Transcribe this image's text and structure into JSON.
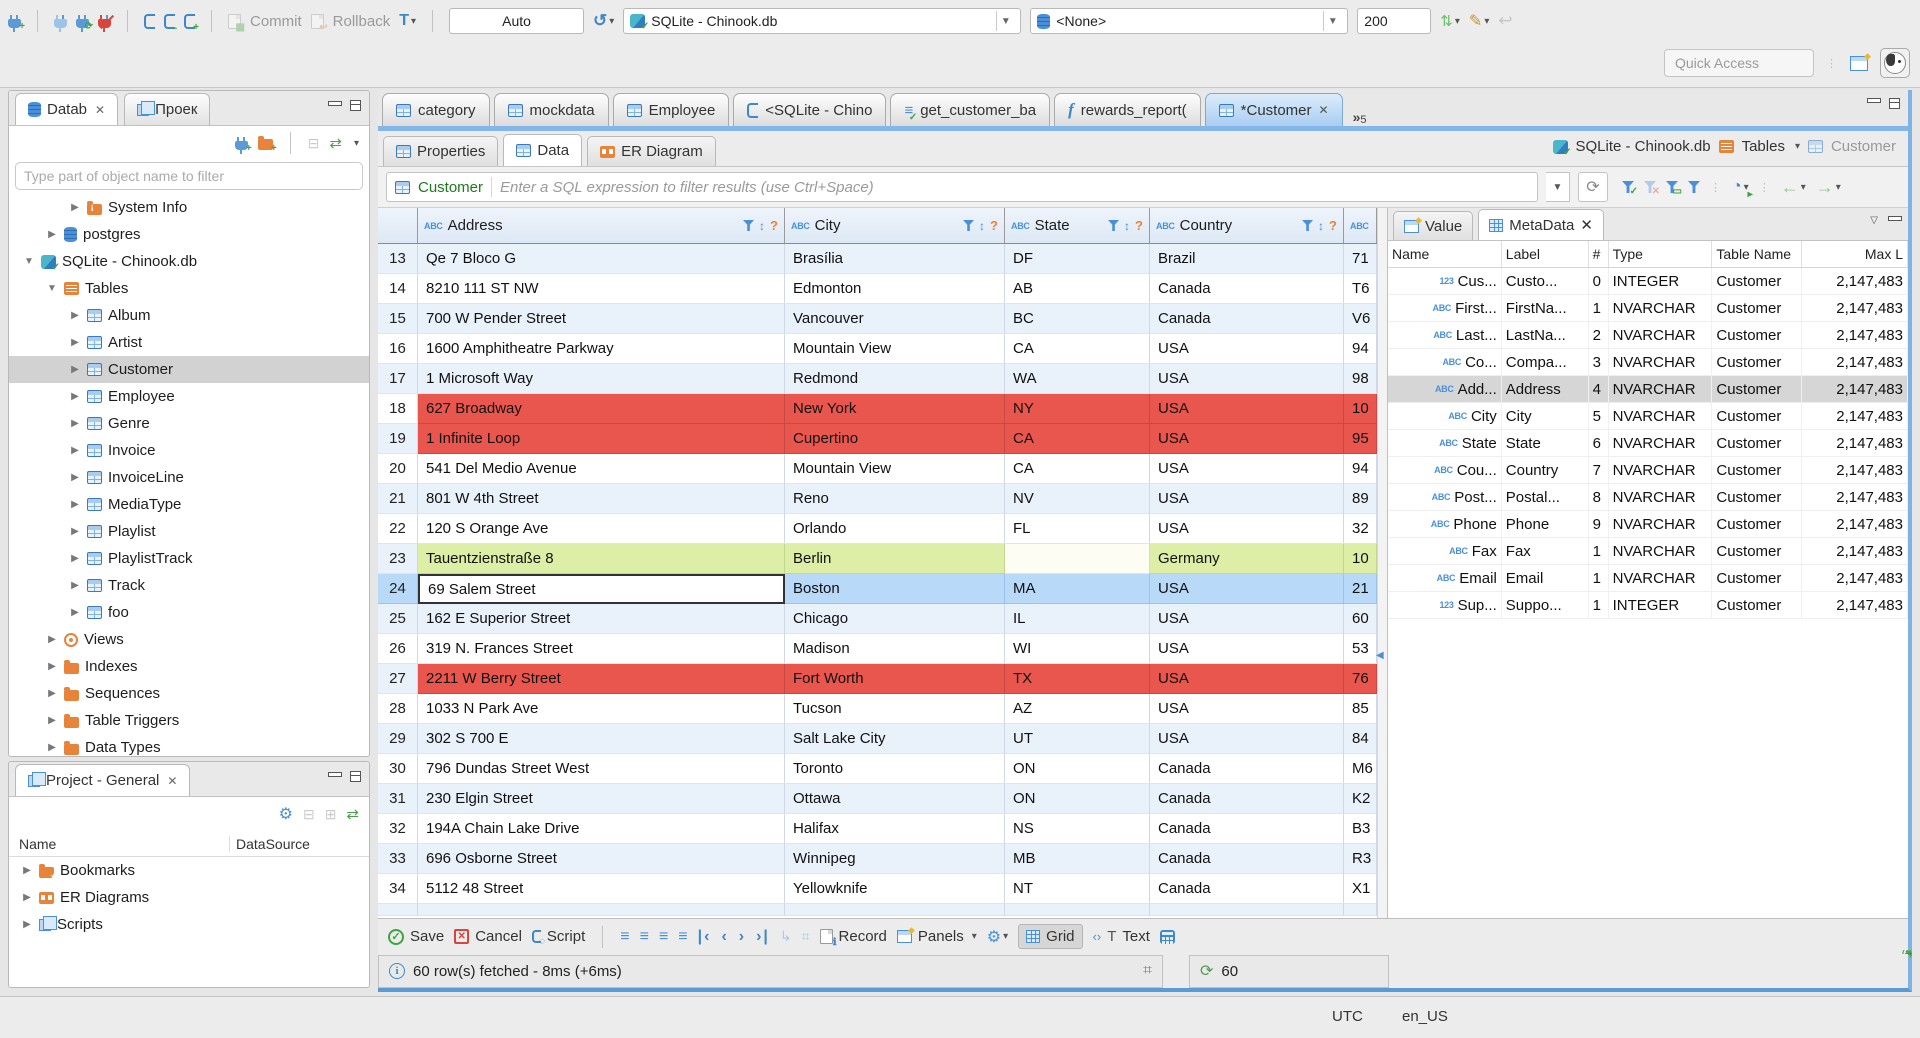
{
  "toolbar": {
    "commit_label": "Commit",
    "rollback_label": "Rollback",
    "txn_mode": "Auto",
    "datasource": "SQLite - Chinook.db",
    "schema": "<None>",
    "fetch_size": "200",
    "quick_access_placeholder": "Quick Access"
  },
  "db_navigator": {
    "tabs": [
      {
        "label": "Datab",
        "closable": true,
        "active": true
      },
      {
        "label": "Проек",
        "closable": false,
        "active": false
      }
    ],
    "filter_placeholder": "Type part of object name to filter",
    "tree": [
      {
        "label": "System Info",
        "icon": "folder-info",
        "depth": 2,
        "arrow": "collapsed"
      },
      {
        "label": "postgres",
        "icon": "db",
        "depth": 1,
        "arrow": "collapsed"
      },
      {
        "label": "SQLite - Chinook.db",
        "icon": "dbfile",
        "depth": 0,
        "arrow": "expanded"
      },
      {
        "label": "Tables",
        "icon": "tables",
        "depth": 1,
        "arrow": "expanded"
      },
      {
        "label": "Album",
        "icon": "table",
        "depth": 2,
        "arrow": "collapsed"
      },
      {
        "label": "Artist",
        "icon": "table",
        "depth": 2,
        "arrow": "collapsed"
      },
      {
        "label": "Customer",
        "icon": "table",
        "depth": 2,
        "arrow": "collapsed",
        "selected": true
      },
      {
        "label": "Employee",
        "icon": "table",
        "depth": 2,
        "arrow": "collapsed"
      },
      {
        "label": "Genre",
        "icon": "table",
        "depth": 2,
        "arrow": "collapsed"
      },
      {
        "label": "Invoice",
        "icon": "table",
        "depth": 2,
        "arrow": "collapsed"
      },
      {
        "label": "InvoiceLine",
        "icon": "table",
        "depth": 2,
        "arrow": "collapsed"
      },
      {
        "label": "MediaType",
        "icon": "table",
        "depth": 2,
        "arrow": "collapsed"
      },
      {
        "label": "Playlist",
        "icon": "table",
        "depth": 2,
        "arrow": "collapsed"
      },
      {
        "label": "PlaylistTrack",
        "icon": "table",
        "depth": 2,
        "arrow": "collapsed"
      },
      {
        "label": "Track",
        "icon": "table",
        "depth": 2,
        "arrow": "collapsed"
      },
      {
        "label": "foo",
        "icon": "table",
        "depth": 2,
        "arrow": "collapsed"
      },
      {
        "label": "Views",
        "icon": "eye",
        "depth": 1,
        "arrow": "collapsed"
      },
      {
        "label": "Indexes",
        "icon": "folder",
        "depth": 1,
        "arrow": "collapsed"
      },
      {
        "label": "Sequences",
        "icon": "folder",
        "depth": 1,
        "arrow": "collapsed"
      },
      {
        "label": "Table Triggers",
        "icon": "folder",
        "depth": 1,
        "arrow": "collapsed"
      },
      {
        "label": "Data Types",
        "icon": "folder",
        "depth": 1,
        "arrow": "collapsed"
      }
    ]
  },
  "project_panel": {
    "title": "Project - General",
    "columns": [
      "Name",
      "DataSource"
    ],
    "items": [
      {
        "label": "Bookmarks",
        "icon": "folder-star"
      },
      {
        "label": "ER Diagrams",
        "icon": "erd"
      },
      {
        "label": "Scripts",
        "icon": "scripts"
      }
    ]
  },
  "editor_tabs": {
    "tabs": [
      {
        "label": "category",
        "icon": "table"
      },
      {
        "label": "mockdata",
        "icon": "table"
      },
      {
        "label": "Employee",
        "icon": "table"
      },
      {
        "label": "<SQLite - Chino",
        "icon": "sql"
      },
      {
        "label": "get_customer_ba",
        "icon": "script"
      },
      {
        "label": "rewards_report(",
        "icon": "function"
      },
      {
        "label": "*Customer",
        "icon": "table",
        "active": true,
        "closable": true
      }
    ],
    "overflow_chevron": "»",
    "overflow_count": "5"
  },
  "result_tabs": [
    {
      "label": "Properties",
      "icon": "table"
    },
    {
      "label": "Data",
      "icon": "table",
      "active": true
    },
    {
      "label": "ER Diagram",
      "icon": "erdtab"
    }
  ],
  "breadcrumb": {
    "datasource": "SQLite - Chinook.db",
    "container": "Tables",
    "entity": "Customer"
  },
  "filter": {
    "entity": "Customer",
    "placeholder": "Enter a SQL expression to filter results (use Ctrl+Space)"
  },
  "grid": {
    "columns": [
      {
        "label": "Address",
        "type": "ABC"
      },
      {
        "label": "City",
        "type": "ABC"
      },
      {
        "label": "State",
        "type": "ABC"
      },
      {
        "label": "Country",
        "type": "ABC"
      },
      {
        "label": "",
        "type": "ABC"
      }
    ],
    "rows": [
      {
        "num": 13,
        "address": "Qe 7 Bloco G",
        "city": "Brasília",
        "state": "DF",
        "country": "Brazil",
        "extra": "71",
        "highlight": "none"
      },
      {
        "num": 14,
        "address": "8210 111 ST NW",
        "city": "Edmonton",
        "state": "AB",
        "country": "Canada",
        "extra": "T6",
        "highlight": "none"
      },
      {
        "num": 15,
        "address": "700 W Pender Street",
        "city": "Vancouver",
        "state": "BC",
        "country": "Canada",
        "extra": "V6",
        "highlight": "none"
      },
      {
        "num": 16,
        "address": "1600 Amphitheatre Parkway",
        "city": "Mountain View",
        "state": "CA",
        "country": "USA",
        "extra": "94",
        "highlight": "none"
      },
      {
        "num": 17,
        "address": "1 Microsoft Way",
        "city": "Redmond",
        "state": "WA",
        "country": "USA",
        "extra": "98",
        "highlight": "none"
      },
      {
        "num": 18,
        "address": "627 Broadway",
        "city": "New York",
        "state": "NY",
        "country": "USA",
        "extra": "10",
        "highlight": "red"
      },
      {
        "num": 19,
        "address": "1 Infinite Loop",
        "city": "Cupertino",
        "state": "CA",
        "country": "USA",
        "extra": "95",
        "highlight": "red"
      },
      {
        "num": 20,
        "address": "541 Del Medio Avenue",
        "city": "Mountain View",
        "state": "CA",
        "country": "USA",
        "extra": "94",
        "highlight": "none"
      },
      {
        "num": 21,
        "address": "801 W 4th Street",
        "city": "Reno",
        "state": "NV",
        "country": "USA",
        "extra": "89",
        "highlight": "none"
      },
      {
        "num": 22,
        "address": "120 S Orange Ave",
        "city": "Orlando",
        "state": "FL",
        "country": "USA",
        "extra": "32",
        "highlight": "none"
      },
      {
        "num": 23,
        "address": "Tauentzienstraße 8",
        "city": "Berlin",
        "state": "",
        "country": "Germany",
        "extra": "10",
        "highlight": "green"
      },
      {
        "num": 24,
        "address": "69 Salem Street",
        "city": "Boston",
        "state": "MA",
        "country": "USA",
        "extra": "21",
        "highlight": "selected"
      },
      {
        "num": 25,
        "address": "162 E Superior Street",
        "city": "Chicago",
        "state": "IL",
        "country": "USA",
        "extra": "60",
        "highlight": "none"
      },
      {
        "num": 26,
        "address": "319 N. Frances Street",
        "city": "Madison",
        "state": "WI",
        "country": "USA",
        "extra": "53",
        "highlight": "none"
      },
      {
        "num": 27,
        "address": "2211 W Berry Street",
        "city": "Fort Worth",
        "state": "TX",
        "country": "USA",
        "extra": "76",
        "highlight": "red"
      },
      {
        "num": 28,
        "address": "1033 N Park Ave",
        "city": "Tucson",
        "state": "AZ",
        "country": "USA",
        "extra": "85",
        "highlight": "none"
      },
      {
        "num": 29,
        "address": "302 S 700 E",
        "city": "Salt Lake City",
        "state": "UT",
        "country": "USA",
        "extra": "84",
        "highlight": "none"
      },
      {
        "num": 30,
        "address": "796 Dundas Street West",
        "city": "Toronto",
        "state": "ON",
        "country": "Canada",
        "extra": "M6",
        "highlight": "none"
      },
      {
        "num": 31,
        "address": "230 Elgin Street",
        "city": "Ottawa",
        "state": "ON",
        "country": "Canada",
        "extra": "K2",
        "highlight": "none"
      },
      {
        "num": 32,
        "address": "194A Chain Lake Drive",
        "city": "Halifax",
        "state": "NS",
        "country": "Canada",
        "extra": "B3",
        "highlight": "none"
      },
      {
        "num": 33,
        "address": "696 Osborne Street",
        "city": "Winnipeg",
        "state": "MB",
        "country": "Canada",
        "extra": "R3",
        "highlight": "none"
      },
      {
        "num": 34,
        "address": "5112 48 Street",
        "city": "Yellowknife",
        "state": "NT",
        "country": "Canada",
        "extra": "X1",
        "highlight": "none"
      }
    ]
  },
  "metadata_panel": {
    "tabs": [
      {
        "label": "Value"
      },
      {
        "label": "MetaData",
        "active": true,
        "closable": true
      }
    ],
    "columns": [
      "Name",
      "Label",
      "#",
      "Type",
      "Table Name",
      "Max L"
    ],
    "rows": [
      {
        "icon": "123",
        "name": "Cus...",
        "label": "Custo...",
        "ord": "0",
        "type": "INTEGER",
        "table": "Customer",
        "max": "2,147,483"
      },
      {
        "icon": "ABC",
        "name": "First...",
        "label": "FirstNa...",
        "ord": "1",
        "type": "NVARCHAR",
        "table": "Customer",
        "max": "2,147,483"
      },
      {
        "icon": "ABC",
        "name": "Last...",
        "label": "LastNa...",
        "ord": "2",
        "type": "NVARCHAR",
        "table": "Customer",
        "max": "2,147,483"
      },
      {
        "icon": "ABC",
        "name": "Co...",
        "label": "Compa...",
        "ord": "3",
        "type": "NVARCHAR",
        "table": "Customer",
        "max": "2,147,483"
      },
      {
        "icon": "ABC",
        "name": "Add...",
        "label": "Address",
        "ord": "4",
        "type": "NVARCHAR",
        "table": "Customer",
        "max": "2,147,483",
        "selected": true
      },
      {
        "icon": "ABC",
        "name": "City",
        "label": "City",
        "ord": "5",
        "type": "NVARCHAR",
        "table": "Customer",
        "max": "2,147,483"
      },
      {
        "icon": "ABC",
        "name": "State",
        "label": "State",
        "ord": "6",
        "type": "NVARCHAR",
        "table": "Customer",
        "max": "2,147,483"
      },
      {
        "icon": "ABC",
        "name": "Cou...",
        "label": "Country",
        "ord": "7",
        "type": "NVARCHAR",
        "table": "Customer",
        "max": "2,147,483"
      },
      {
        "icon": "ABC",
        "name": "Post...",
        "label": "Postal...",
        "ord": "8",
        "type": "NVARCHAR",
        "table": "Customer",
        "max": "2,147,483"
      },
      {
        "icon": "ABC",
        "name": "Phone",
        "label": "Phone",
        "ord": "9",
        "type": "NVARCHAR",
        "table": "Customer",
        "max": "2,147,483"
      },
      {
        "icon": "ABC",
        "name": "Fax",
        "label": "Fax",
        "ord": "1",
        "type": "NVARCHAR",
        "table": "Customer",
        "max": "2,147,483"
      },
      {
        "icon": "ABC",
        "name": "Email",
        "label": "Email",
        "ord": "1",
        "type": "NVARCHAR",
        "table": "Customer",
        "max": "2,147,483"
      },
      {
        "icon": "123",
        "name": "Sup...",
        "label": "Suppo...",
        "ord": "1",
        "type": "INTEGER",
        "table": "Customer",
        "max": "2,147,483"
      }
    ]
  },
  "bottom_toolbar": {
    "save_label": "Save",
    "cancel_label": "Cancel",
    "script_label": "Script",
    "record_label": "Record",
    "panels_label": "Panels",
    "grid_label": "Grid",
    "text_label": "Text"
  },
  "status": {
    "fetch_status": "60 row(s) fetched - 8ms (+6ms)",
    "auto_refresh_count": "60"
  },
  "window_statusbar": {
    "timezone": "UTC",
    "locale": "en_US"
  }
}
